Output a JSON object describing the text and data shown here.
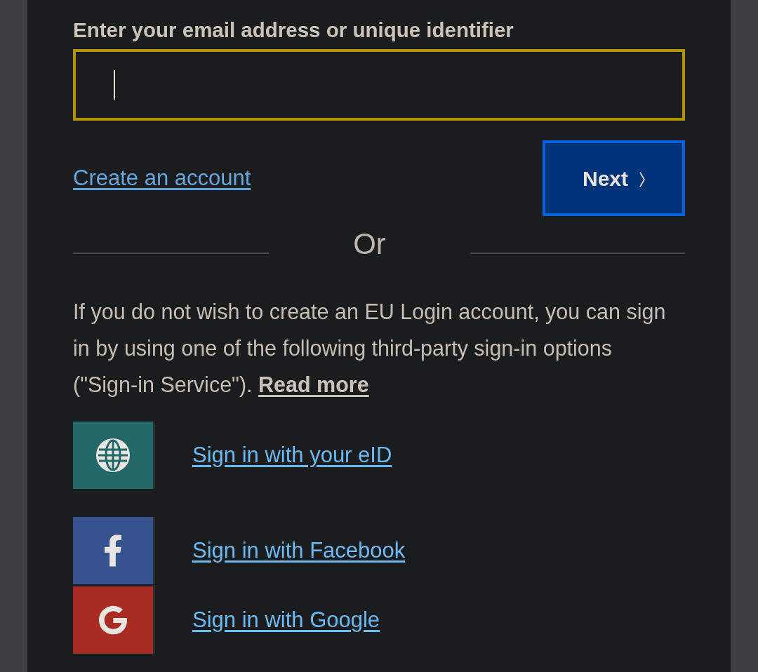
{
  "email_field": {
    "label": "Enter your email address or unique identifier",
    "focused": true
  },
  "create_account_link": "Create an account",
  "next_button": "Next",
  "divider": "Or",
  "notice": {
    "text": "If you do not wish to create an EU Login account, you can sign in by using one of the following third-party sign-in options (\"Sign-in Service\").",
    "link": "Read more"
  },
  "sign_in_options": [
    {
      "kind": "eid",
      "label": "Sign in with your eID",
      "color": "#226868"
    },
    {
      "kind": "facebook",
      "label": "Sign in with Facebook",
      "color": "#36528f"
    },
    {
      "kind": "google",
      "label": "Sign in with Google",
      "color": "#a92c22"
    }
  ]
}
